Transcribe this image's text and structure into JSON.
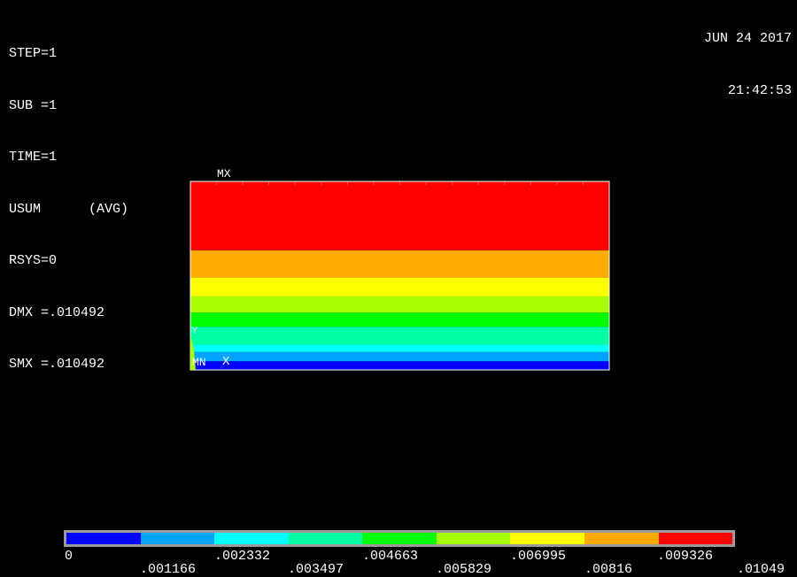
{
  "info_lines": [
    "STEP=1",
    "SUB =1",
    "TIME=1",
    "USUM      (AVG)",
    "RSYS=0",
    "DMX =.010492",
    "SMX =.010492"
  ],
  "datetime": {
    "date": "JUN 24 2017",
    "time": "21:42:53"
  },
  "plot_labels": {
    "max": "MX",
    "min": "MN",
    "x_axis": "X",
    "y_axis": "Y"
  },
  "contour_colors": [
    "#0000ff",
    "#00a2ff",
    "#00ffff",
    "#00ffa5",
    "#00ff00",
    "#a8ff00",
    "#ffff00",
    "#ffaa00",
    "#ff0000"
  ],
  "band_boundaries_fraction": [
    0.0,
    0.046,
    0.095,
    0.134,
    0.229,
    0.304,
    0.39,
    0.49,
    0.635,
    1.0
  ],
  "legend": {
    "row1": [
      "0",
      ".002332",
      ".004663",
      ".006995",
      ".009326"
    ],
    "row2": [
      ".001166",
      ".003497",
      ".005829",
      ".00816",
      ".01049"
    ]
  }
}
